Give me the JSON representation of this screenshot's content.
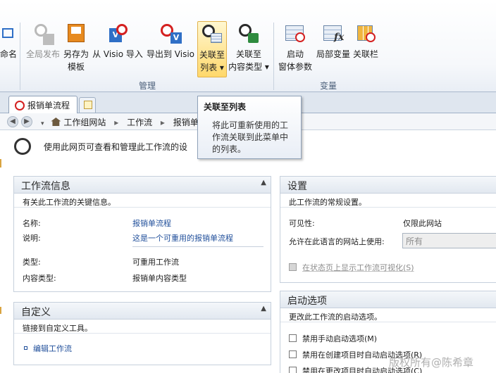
{
  "ribbon": {
    "buttons": [
      {
        "line1": "命名",
        "line2": ""
      },
      {
        "line1": "全局发布",
        "line2": ""
      },
      {
        "line1": "另存为",
        "line2": "模板"
      },
      {
        "line1": "从 Visio 导入",
        "line2": ""
      },
      {
        "line1": "导出到 Visio",
        "line2": ""
      },
      {
        "line1": "关联至",
        "line2": "列表 ▾"
      },
      {
        "line1": "关联至",
        "line2": "内容类型 ▾"
      },
      {
        "line1": "启动",
        "line2": "窗体参数"
      },
      {
        "line1": "局部变量",
        "line2": ""
      },
      {
        "line1": "关联栏",
        "line2": ""
      }
    ],
    "groups": {
      "manage": "管理",
      "variables": "变量"
    }
  },
  "tooltip": {
    "title": "关联至列表",
    "description": "将此可重新使用的工作流关联到此菜单中的列表。"
  },
  "tab": {
    "label": "报销单流程"
  },
  "breadcrumb": {
    "items": [
      "工作组网站",
      "工作流",
      "报销单流"
    ]
  },
  "heading": {
    "text": "使用此网页可查看和管理此工作流的设"
  },
  "workflow_info": {
    "title": "工作流信息",
    "description": "有关此工作流的关键信息。",
    "name_label": "名称:",
    "name_value": "报销单流程",
    "desc_label": "说明:",
    "desc_value": "这是一个可重用的报销单流程",
    "type_label": "类型:",
    "type_value": "可重用工作流",
    "ctype_label": "内容类型:",
    "ctype_value": "报销单内容类型"
  },
  "customize": {
    "title": "自定义",
    "description": "链接到自定义工具。",
    "edit_link": "编辑工作流"
  },
  "settings": {
    "title": "设置",
    "description": "此工作流的常规设置。",
    "visibility_label": "可见性:",
    "visibility_value": "仅限此网站",
    "language_label": "允许在此语言的网站上使用:",
    "language_value": "所有",
    "visualize_label": "在状态页上显示工作流可视化(S)"
  },
  "startup": {
    "title": "启动选项",
    "description": "更改此工作流的启动选项。",
    "opt1": "禁用手动启动选项(M)",
    "opt2": "禁用在创建项目时自动启动选项(R)",
    "opt3": "禁用在更改项目时自动启动选项(C)"
  },
  "watermark": "版权所有@陈希章"
}
